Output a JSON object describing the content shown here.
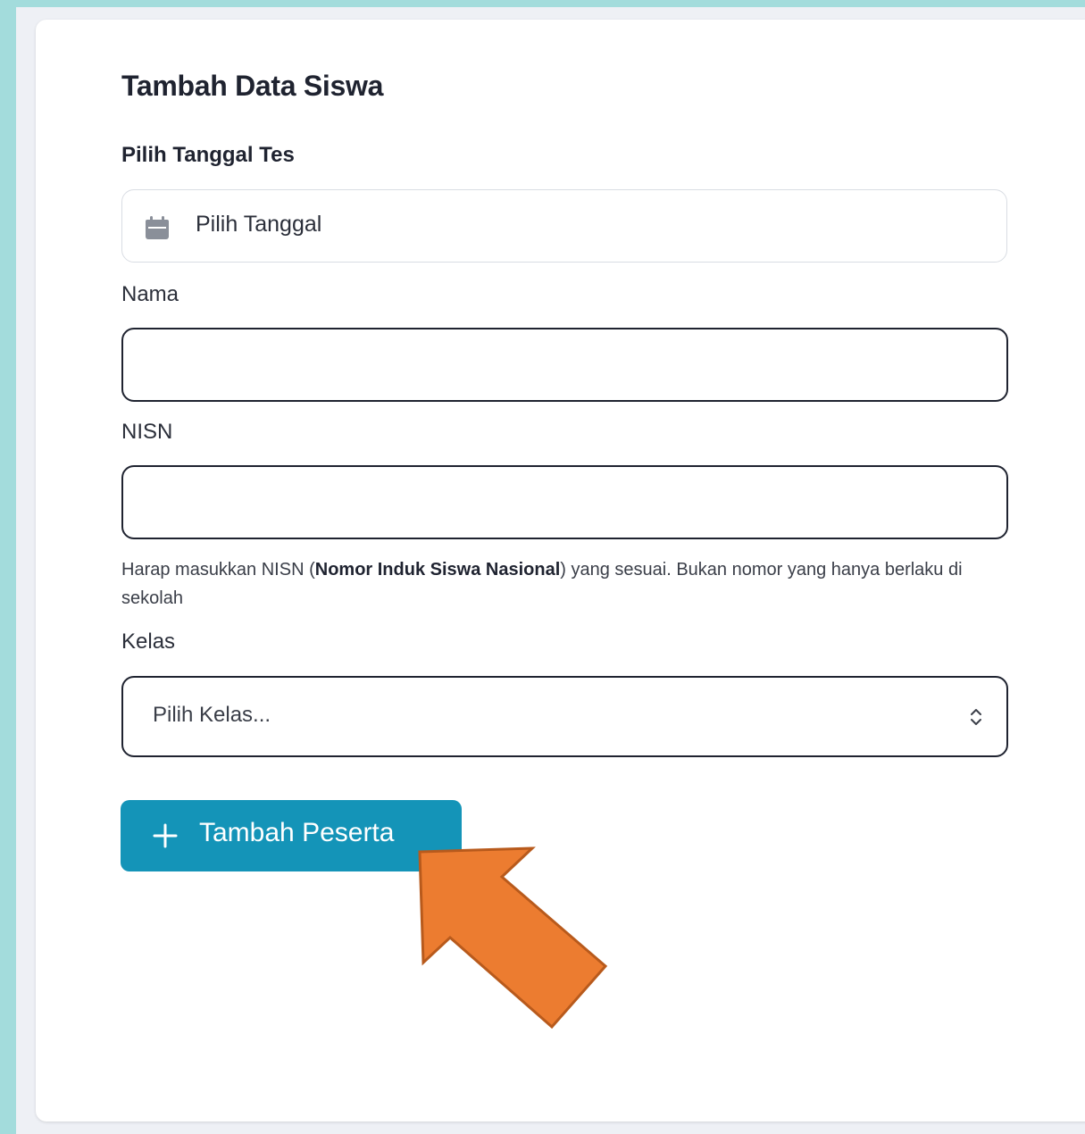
{
  "form": {
    "title": "Tambah Data Siswa",
    "date_label": "Pilih Tanggal Tes",
    "date_placeholder": "Pilih Tanggal",
    "name_label": "Nama",
    "name_value": "",
    "nisn_label": "NISN",
    "nisn_value": "",
    "nisn_help_prefix": "Harap masukkan NISN (",
    "nisn_help_bold": "Nomor Induk Siswa Nasional",
    "nisn_help_suffix": ") yang sesuai. Bukan nomor yang hanya berlaku di sekolah",
    "class_label": "Kelas",
    "class_selected": "Pilih Kelas...",
    "submit_label": "Tambah Peserta"
  },
  "icons": {
    "date": "calendar-icon",
    "select": "chevron-up-down-icon",
    "submit": "plus-icon",
    "annotation": "arrow-annotation"
  },
  "colors": {
    "background": "#a3dcdc",
    "primary_button": "#1494b8",
    "annotation_arrow": "#ec7c30"
  }
}
